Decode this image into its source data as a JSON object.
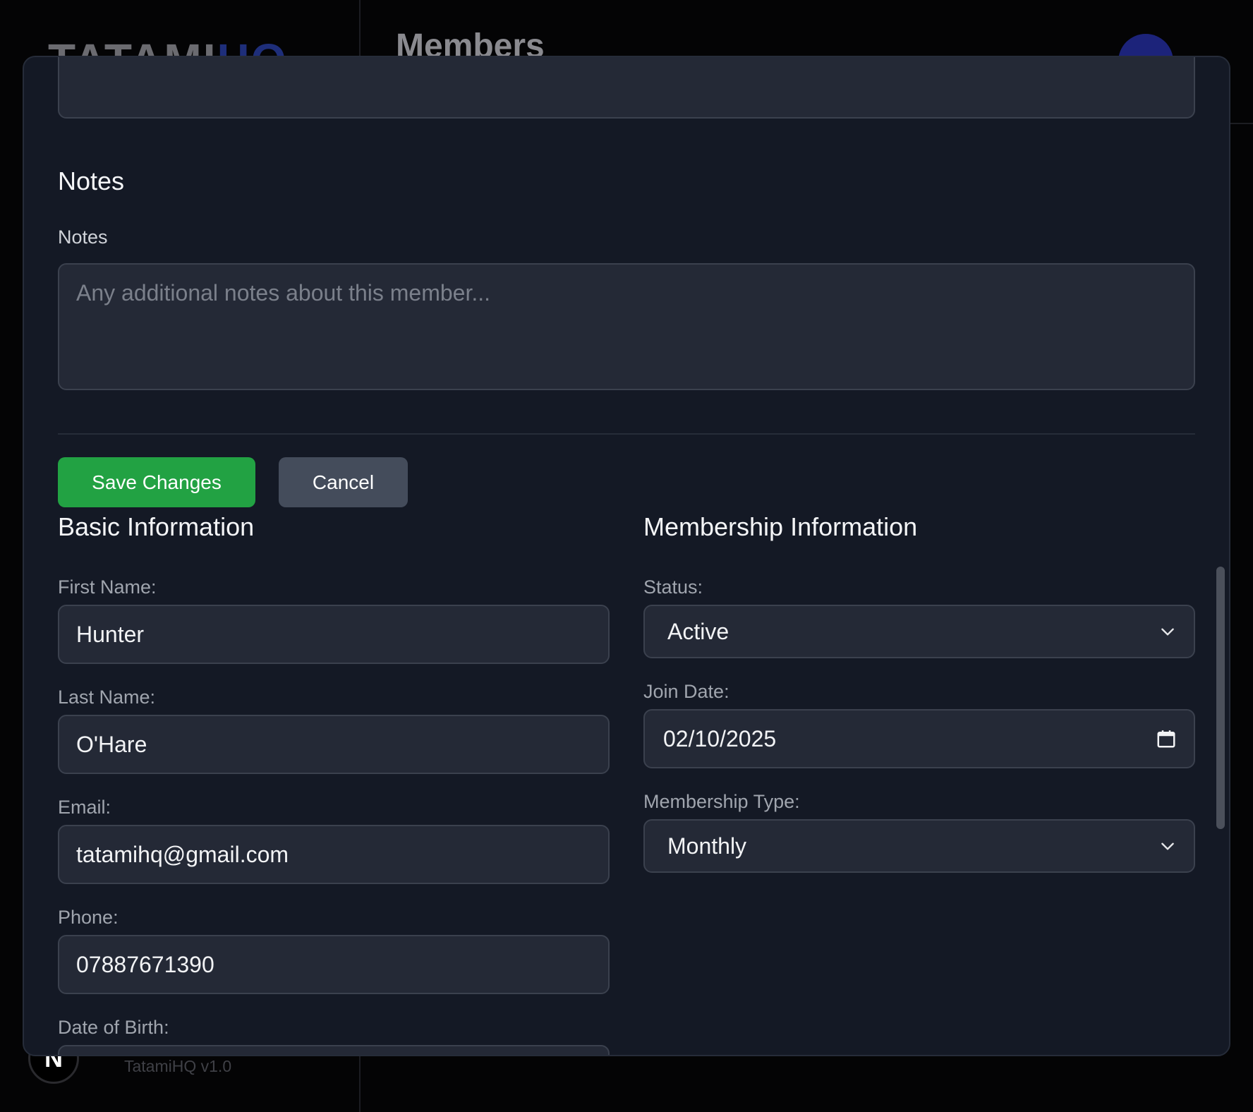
{
  "background": {
    "logo_part1": "TATAMI",
    "logo_part2": "HQ",
    "page_title": "Members",
    "version": "TatamiHQ v1.0",
    "next_badge": "N"
  },
  "notes_section": {
    "heading": "Notes",
    "label": "Notes",
    "placeholder": "Any additional notes about this member..."
  },
  "actions": {
    "save_label": "Save Changes",
    "cancel_label": "Cancel"
  },
  "basic_info": {
    "heading": "Basic Information",
    "first_name_label": "First Name:",
    "first_name_value": "Hunter",
    "last_name_label": "Last Name:",
    "last_name_value": "O'Hare",
    "email_label": "Email:",
    "email_value": "tatamihq@gmail.com",
    "phone_label": "Phone:",
    "phone_value": "07887671390",
    "dob_label": "Date of Birth:"
  },
  "membership_info": {
    "heading": "Membership Information",
    "status_label": "Status:",
    "status_value": "Active",
    "join_date_label": "Join Date:",
    "join_date_value": "02/10/2025",
    "type_label": "Membership Type:",
    "type_value": "Monthly"
  },
  "colors": {
    "save_button": "#22a243",
    "cancel_button": "#444c5b",
    "modal_bg": "#141925",
    "input_bg": "#242936"
  }
}
